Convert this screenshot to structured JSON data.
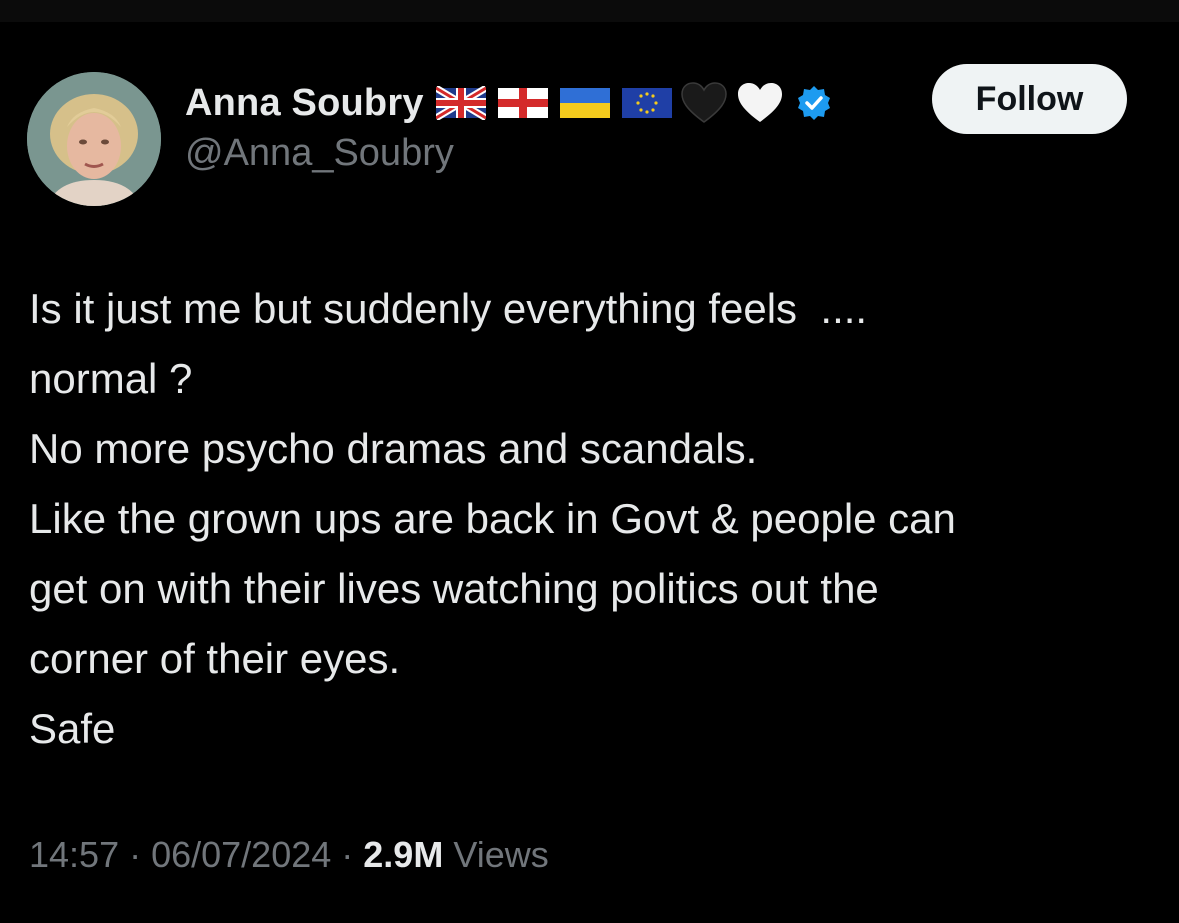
{
  "author": {
    "display_name": "Anna Soubry",
    "handle": "@Anna_Soubry",
    "name_emojis": [
      "uk-flag",
      "england-flag",
      "ukraine-flag",
      "eu-flag",
      "black-heart",
      "white-heart"
    ],
    "verified_color": "#1d9bf0"
  },
  "follow_label": "Follow",
  "tweet": {
    "lines": [
      "Is it just me but suddenly everything feels  ....",
      "normal ?",
      "No more psycho dramas and scandals.",
      "Like the grown ups are back in Govt & people can",
      "get on with their lives watching politics out the",
      "corner of their eyes.",
      "Safe"
    ]
  },
  "meta": {
    "time": "14:57",
    "sep1": " · ",
    "date": "06/07/2024",
    "sep2": " · ",
    "views_count": "2.9M",
    "views_label": " Views"
  },
  "colors": {
    "background": "#000000",
    "text_primary": "#e7e9ea",
    "text_secondary": "#71767b",
    "follow_bg": "#eff3f4"
  }
}
